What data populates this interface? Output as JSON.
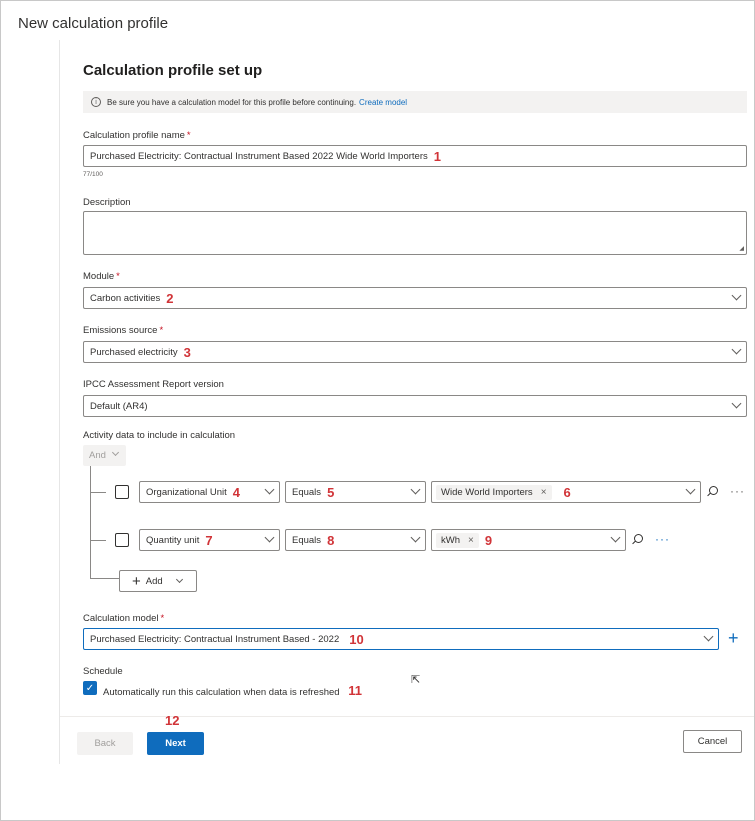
{
  "window": {
    "title": "New calculation profile"
  },
  "section": {
    "title": "Calculation profile set up"
  },
  "info": {
    "icon": "info-icon",
    "text": "Be sure you have a calculation model for this profile before continuing.",
    "link": "Create model"
  },
  "profile_name": {
    "label": "Calculation profile name",
    "required": "*",
    "value": "Purchased Electricity: Contractual Instrument Based 2022 Wide World Importers",
    "counter": "77/100",
    "marker": "1"
  },
  "description": {
    "label": "Description",
    "value": ""
  },
  "module": {
    "label": "Module",
    "required": "*",
    "value": "Carbon activities",
    "marker": "2"
  },
  "emissions_source": {
    "label": "Emissions source",
    "required": "*",
    "value": "Purchased electricity",
    "marker": "3"
  },
  "ipcc": {
    "label": "IPCC Assessment Report version",
    "value": "Default (AR4)"
  },
  "activity": {
    "label": "Activity data to include in calculation",
    "operator": "And",
    "rows": [
      {
        "field": "Organizational Unit",
        "field_marker": "4",
        "condition": "Equals",
        "condition_marker": "5",
        "value": "Wide World Importers",
        "value_marker": "6",
        "remove": "×",
        "more": "···"
      },
      {
        "field": "Quantity unit",
        "field_marker": "7",
        "condition": "Equals",
        "condition_marker": "8",
        "value": "kWh",
        "value_marker": "9",
        "remove": "×",
        "more": "···"
      }
    ],
    "add_label": "Add",
    "add_symbol": "+"
  },
  "calc_model": {
    "label": "Calculation model",
    "required": "*",
    "value": "Purchased Electricity: Contractual Instrument Based - 2022",
    "marker": "10",
    "add_symbol": "+"
  },
  "schedule": {
    "label": "Schedule",
    "checkbox_label": "Automatically run this calculation when data is refreshed",
    "checked": "✓",
    "marker": "11"
  },
  "footer": {
    "back": "Back",
    "next": "Next",
    "next_marker": "12",
    "cancel": "Cancel"
  },
  "colors": {
    "accent": "#0f6cbd",
    "marker": "#d13438",
    "required": "#c50f1f"
  }
}
